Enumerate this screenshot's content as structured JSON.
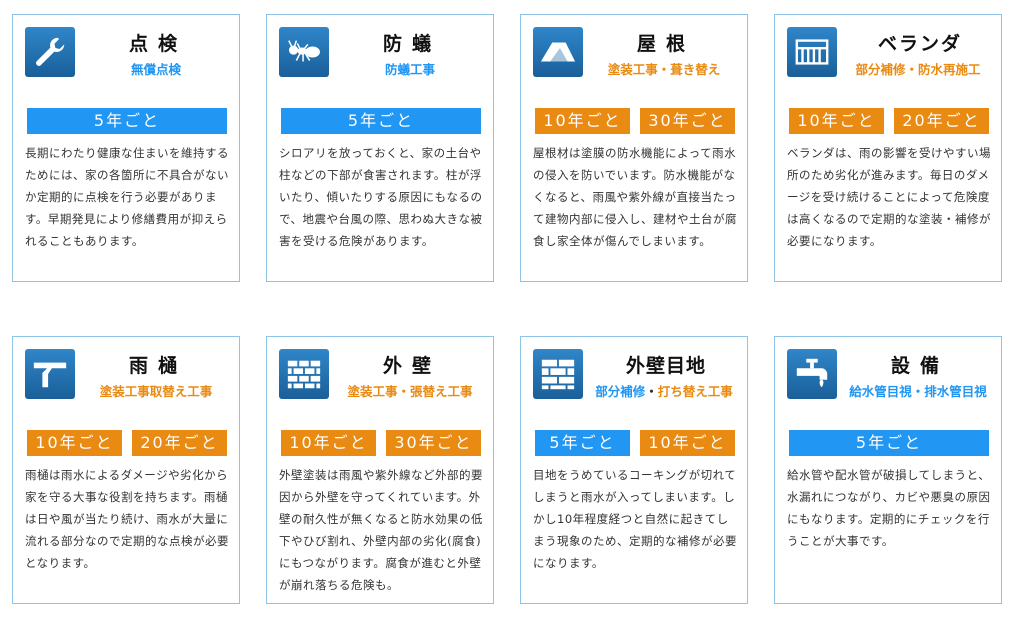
{
  "colors": {
    "blue": "#2196f3",
    "orange": "#e98a12",
    "border": "#8fc4e6",
    "icon_bg": "#1f6fb2"
  },
  "cards": [
    {
      "icon": "wrench-icon",
      "title": "点検",
      "subtitle": [
        {
          "text": "無償点検",
          "color": "blue"
        }
      ],
      "badges": [
        {
          "text": "5年ごと",
          "color": "blue"
        }
      ],
      "description": "長期にわたり健康な住まいを維持するためには、家の各箇所に不具合がないか定期的に点検を行う必要があります。早期発見により修繕費用が抑えられることもあります。"
    },
    {
      "icon": "ant-icon",
      "title": "防蟻",
      "subtitle": [
        {
          "text": "防蟻工事",
          "color": "blue"
        }
      ],
      "badges": [
        {
          "text": "5年ごと",
          "color": "blue"
        }
      ],
      "description": "シロアリを放っておくと、家の土台や柱などの下部が食害されます。柱が浮いたり、傾いたりする原因にもなるので、地震や台風の際、思わぬ大きな被害を受ける危険があります。"
    },
    {
      "icon": "roof-icon",
      "title": "屋根",
      "subtitle": [
        {
          "text": "塗装工事・葺き替え",
          "color": "orange"
        }
      ],
      "badges": [
        {
          "text": "10年ごと",
          "color": "orange"
        },
        {
          "text": "30年ごと",
          "color": "orange"
        }
      ],
      "description": "屋根材は塗膜の防水機能によって雨水の侵入を防いでいます。防水機能がなくなると、雨風や紫外線が直接当たって建物内部に侵入し、建材や土台が腐食し家全体が傷んでしまいます。"
    },
    {
      "icon": "balcony-icon",
      "title": "ベランダ",
      "subtitle": [
        {
          "text": "部分補修・防水再施工",
          "color": "orange"
        }
      ],
      "badges": [
        {
          "text": "10年ごと",
          "color": "orange"
        },
        {
          "text": "20年ごと",
          "color": "orange"
        }
      ],
      "description": "ベランダは、雨の影響を受けやすい場所のため劣化が進みます。毎日のダメージを受け続けることによって危険度は高くなるので定期的な塗装・補修が必要になります。"
    },
    {
      "icon": "gutter-icon",
      "title": "雨樋",
      "subtitle": [
        {
          "text": "塗装工事取替え工事",
          "color": "orange"
        }
      ],
      "badges": [
        {
          "text": "10年ごと",
          "color": "orange"
        },
        {
          "text": "20年ごと",
          "color": "orange"
        }
      ],
      "description": "雨樋は雨水によるダメージや劣化から家を守る大事な役割を持ちます。雨樋は日や風が当たり続け、雨水が大量に流れる部分なので定期的な点検が必要となります。"
    },
    {
      "icon": "brick-wall-icon",
      "title": "外壁",
      "subtitle": [
        {
          "text": "塗装工事・張替え工事",
          "color": "orange"
        }
      ],
      "badges": [
        {
          "text": "10年ごと",
          "color": "orange"
        },
        {
          "text": "30年ごと",
          "color": "orange"
        }
      ],
      "description": "外壁塗装は雨風や紫外線など外部的要因から外壁を守ってくれています。外壁の耐久性が無くなると防水効果の低下やひび割れ、外壁内部の劣化(腐食)にもつながります。腐食が進むと外壁が崩れ落ちる危険も。"
    },
    {
      "icon": "wall-joint-icon",
      "title": "外壁目地",
      "subtitle": [
        {
          "text": "部分補修",
          "color": "blue"
        },
        {
          "text": "・",
          "color": "dot"
        },
        {
          "text": "打ち替え工事",
          "color": "orange"
        }
      ],
      "badges": [
        {
          "text": "5年ごと",
          "color": "blue"
        },
        {
          "text": "10年ごと",
          "color": "orange"
        }
      ],
      "description": "目地をうめているコーキングが切れてしまうと雨水が入ってしまいます。しかし10年程度経つと自然に起きてしまう現象のため、定期的な補修が必要になります。"
    },
    {
      "icon": "faucet-icon",
      "title": "設備",
      "subtitle": [
        {
          "text": "給水管目視・排水管目視",
          "color": "blue"
        }
      ],
      "badges": [
        {
          "text": "5年ごと",
          "color": "blue"
        }
      ],
      "description": "給水管や配水管が破損してしまうと、水漏れにつながり、カビや悪臭の原因にもなります。定期的にチェックを行うことが大事です。"
    }
  ]
}
